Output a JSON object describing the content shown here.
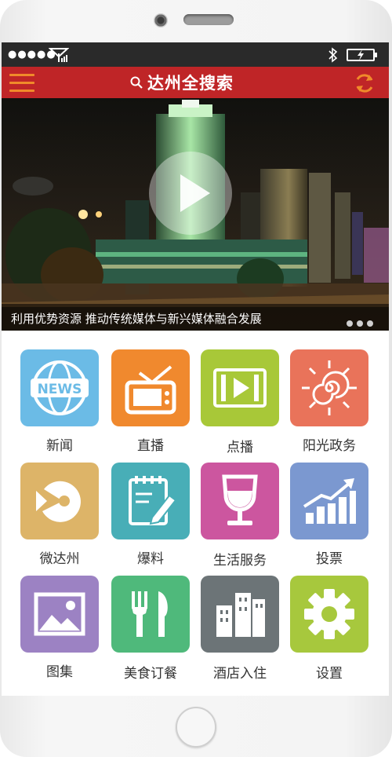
{
  "header": {
    "title": "达州全搜索"
  },
  "banner": {
    "caption": "利用优势资源  推动传统媒体与新兴媒体融合发展"
  },
  "colors": {
    "header_bg": "#bf2527",
    "accent": "#f08a2a",
    "statusbar_bg": "#2a2a2a"
  },
  "grid": {
    "items": [
      {
        "label": "新闻",
        "icon": "news-globe-icon",
        "color": "#6bbbe6"
      },
      {
        "label": "直播",
        "icon": "tv-icon",
        "color": "#f0892e"
      },
      {
        "label": "点播",
        "icon": "film-play-icon",
        "color": "#a8c838"
      },
      {
        "label": "阳光政务",
        "icon": "sun-swirl-icon",
        "color": "#e9735a"
      },
      {
        "label": "微达州",
        "icon": "pacman-icon",
        "color": "#ddb468"
      },
      {
        "label": "爆料",
        "icon": "notepad-pencil-icon",
        "color": "#48aeb7"
      },
      {
        "label": "生活服务",
        "icon": "wine-glass-icon",
        "color": "#cc569f"
      },
      {
        "label": "投票",
        "icon": "bar-chart-arrow-icon",
        "color": "#7b98d0"
      },
      {
        "label": "图集",
        "icon": "picture-icon",
        "color": "#9c82c3"
      },
      {
        "label": "美食订餐",
        "icon": "fork-knife-icon",
        "color": "#4fb97b"
      },
      {
        "label": "酒店入住",
        "icon": "buildings-icon",
        "color": "#6c7477"
      },
      {
        "label": "设置",
        "icon": "gear-icon",
        "color": "#a7c83d"
      }
    ]
  }
}
